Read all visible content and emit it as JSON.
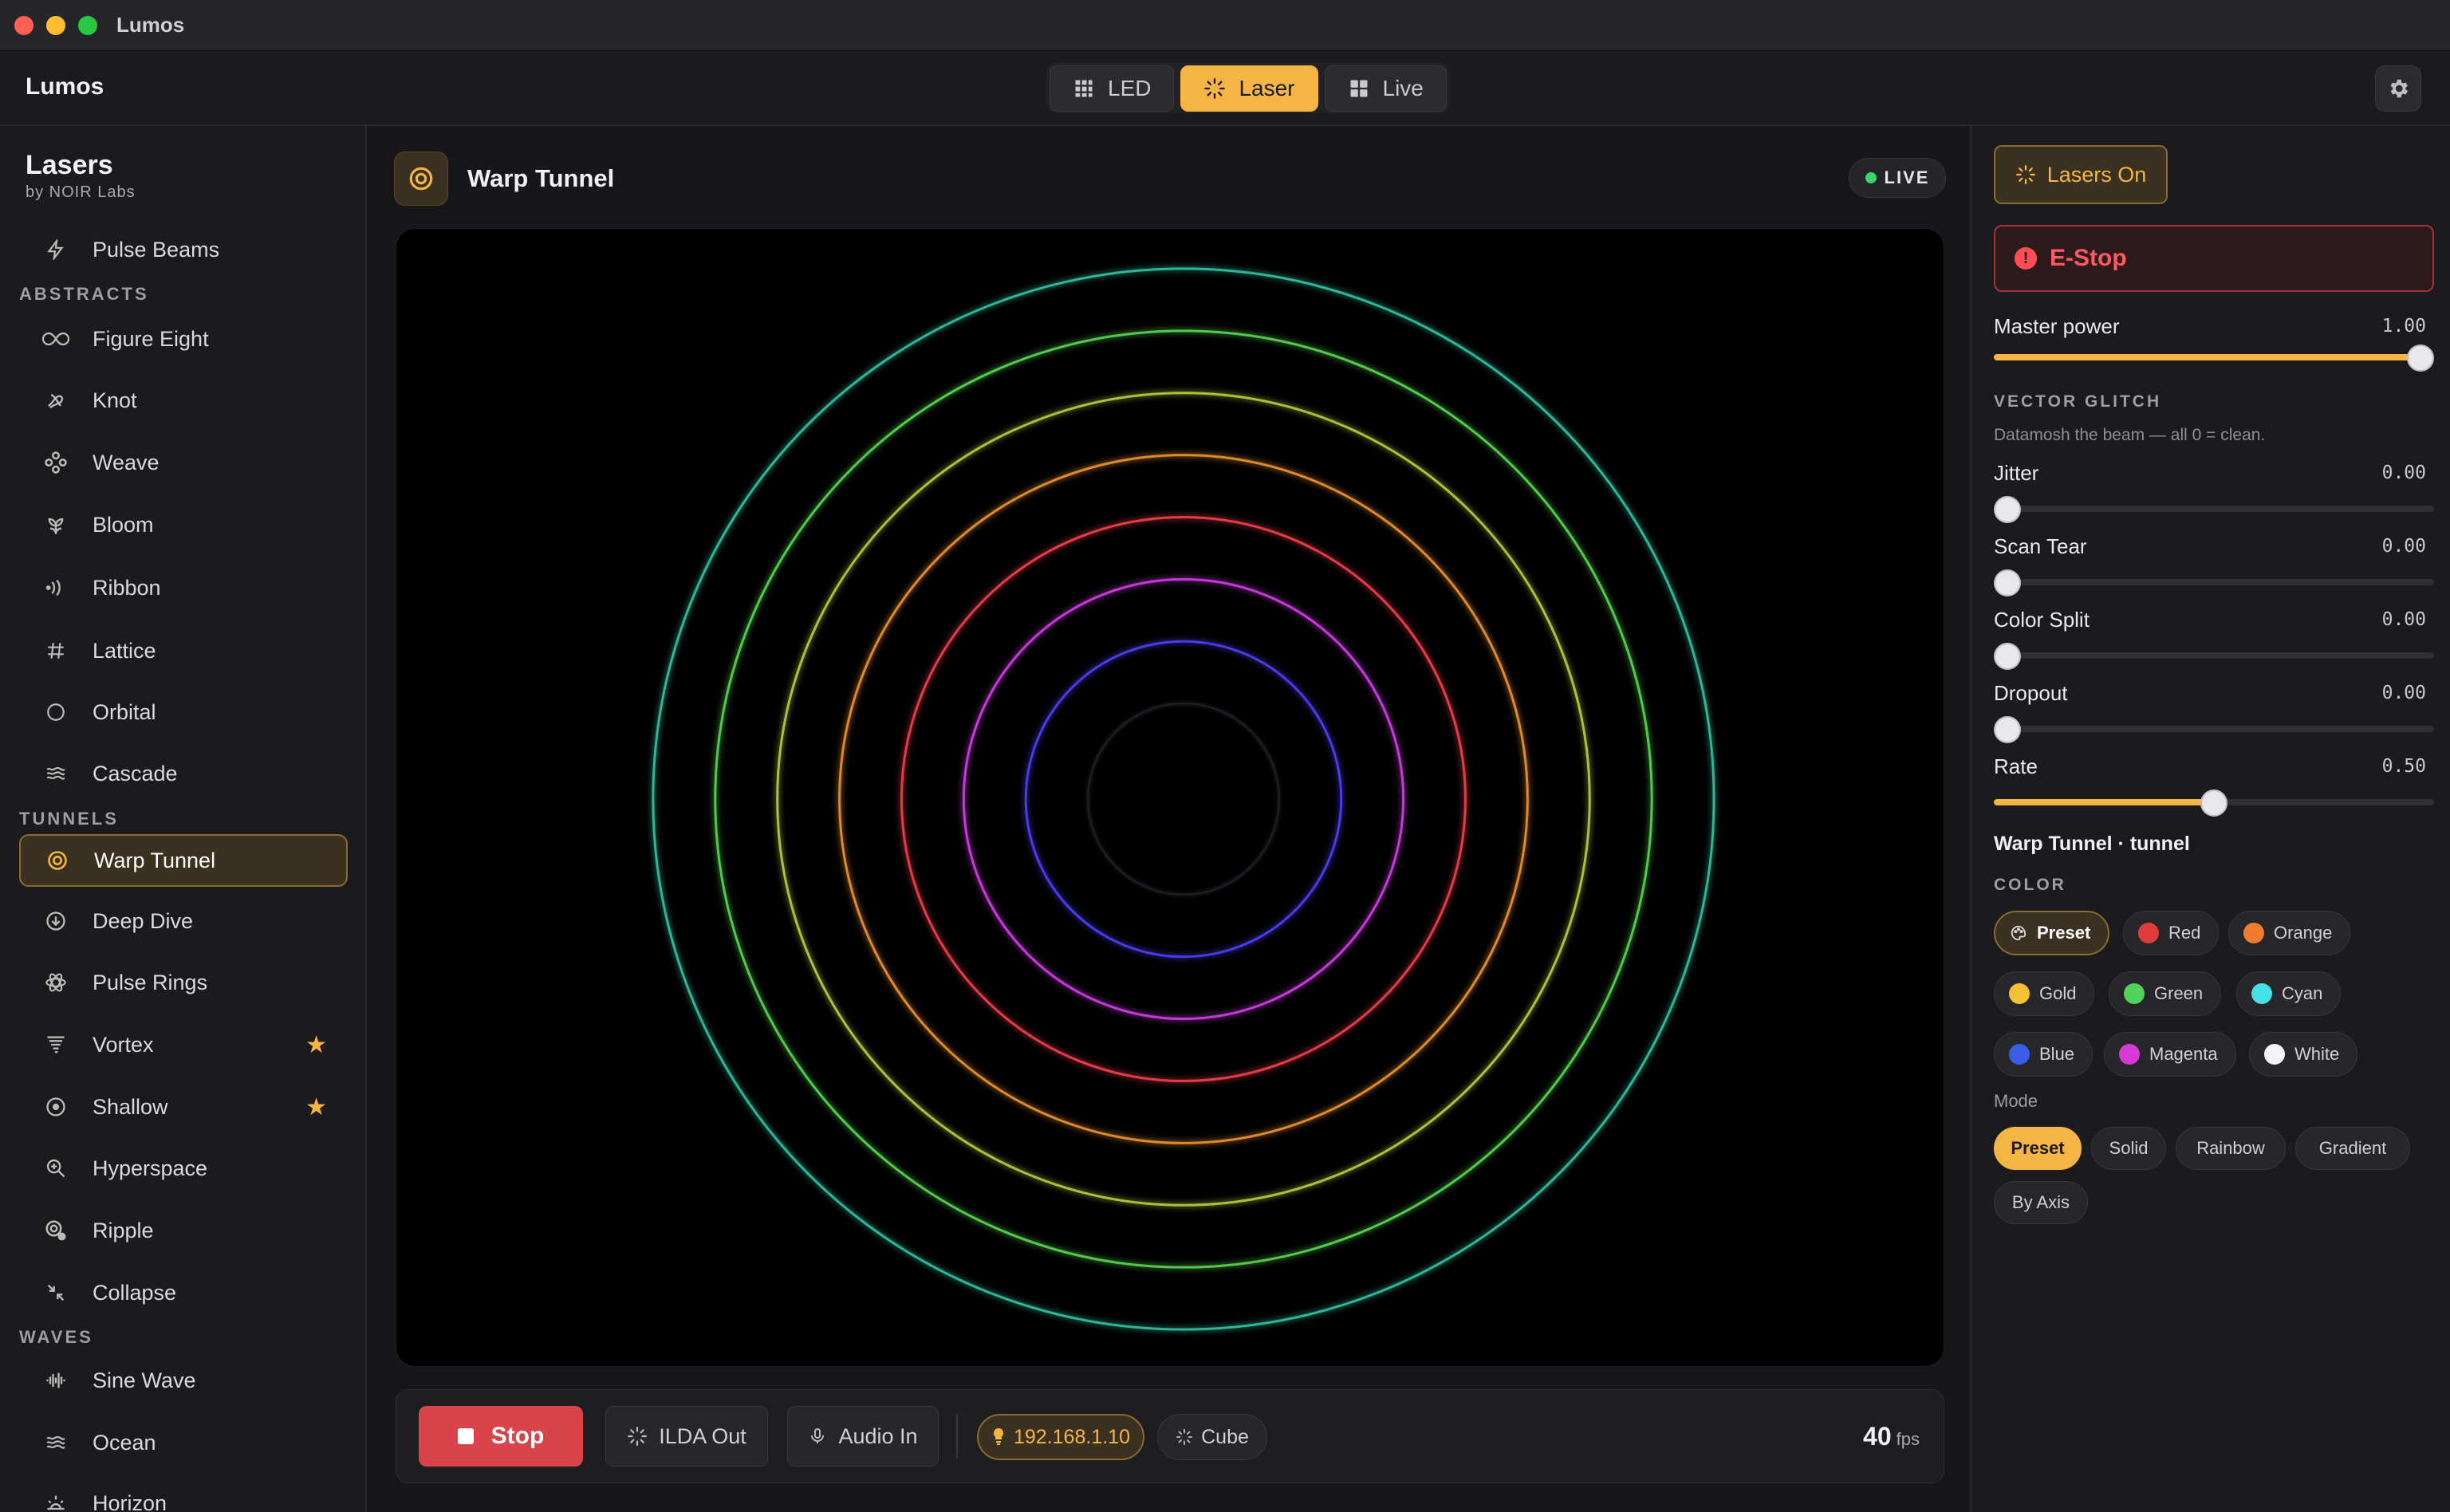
{
  "window": {
    "title": "Lumos"
  },
  "header": {
    "brand": "Lumos",
    "tabs": [
      {
        "label": "LED",
        "icon": "grid-icon",
        "active": false
      },
      {
        "label": "Laser",
        "icon": "sparkle-icon",
        "active": true
      },
      {
        "label": "Live",
        "icon": "layout-icon",
        "active": false
      }
    ]
  },
  "sidebar": {
    "title": "Lasers",
    "subtitle": "by NOIR Labs",
    "top_items": [
      {
        "label": "Pulse Beams",
        "icon": "lightning-icon"
      }
    ],
    "sections": [
      {
        "title": "ABSTRACTS",
        "items": [
          {
            "label": "Figure Eight",
            "icon": "infinity-icon"
          },
          {
            "label": "Knot",
            "icon": "knot-icon"
          },
          {
            "label": "Weave",
            "icon": "weave-icon"
          },
          {
            "label": "Bloom",
            "icon": "flower-icon"
          },
          {
            "label": "Ribbon",
            "icon": "waves-right-icon"
          },
          {
            "label": "Lattice",
            "icon": "hash-icon"
          },
          {
            "label": "Orbital",
            "icon": "circle-icon"
          },
          {
            "label": "Cascade",
            "icon": "cascade-icon"
          }
        ]
      },
      {
        "title": "TUNNELS",
        "items": [
          {
            "label": "Warp Tunnel",
            "icon": "target-icon",
            "active": true
          },
          {
            "label": "Deep Dive",
            "icon": "arrow-down-circle-icon"
          },
          {
            "label": "Pulse Rings",
            "icon": "atom-icon"
          },
          {
            "label": "Vortex",
            "icon": "tornado-icon",
            "starred": true
          },
          {
            "label": "Shallow",
            "icon": "dot-circle-icon",
            "starred": true
          },
          {
            "label": "Hyperspace",
            "icon": "zoom-icon"
          },
          {
            "label": "Ripple",
            "icon": "ripple-icon"
          },
          {
            "label": "Collapse",
            "icon": "collapse-icon"
          }
        ]
      },
      {
        "title": "WAVES",
        "items": [
          {
            "label": "Sine Wave",
            "icon": "audio-wave-icon"
          },
          {
            "label": "Ocean",
            "icon": "ocean-icon"
          },
          {
            "label": "Horizon",
            "icon": "sunrise-icon"
          }
        ]
      }
    ]
  },
  "main": {
    "title": "Warp Tunnel",
    "live_label": "LIVE",
    "rings": [
      {
        "color": "#2fb59a"
      },
      {
        "color": "#52c84e"
      },
      {
        "color": "#a9c13a"
      },
      {
        "color": "#df8a2a"
      },
      {
        "color": "#e23a4a"
      },
      {
        "color": "#c33ad6"
      },
      {
        "color": "#4a3ae8"
      },
      {
        "color": "#1e1e22"
      }
    ]
  },
  "transport": {
    "stop_label": "Stop",
    "ilda_label": "ILDA Out",
    "audio_label": "Audio In",
    "ip_label": "192.168.1.10",
    "cube_label": "Cube",
    "fps_value": "40",
    "fps_unit": "fps"
  },
  "panel": {
    "lasers_on_label": "Lasers On",
    "estop_label": "E-Stop",
    "master": {
      "label": "Master power",
      "value": "1.00",
      "level": 1.0
    },
    "glitch_title": "VECTOR GLITCH",
    "glitch_desc": "Datamosh the beam — all 0 = clean.",
    "sliders": [
      {
        "label": "Jitter",
        "value": "0.00",
        "level": 0.0
      },
      {
        "label": "Scan Tear",
        "value": "0.00",
        "level": 0.0
      },
      {
        "label": "Color Split",
        "value": "0.00",
        "level": 0.0
      },
      {
        "label": "Dropout",
        "value": "0.00",
        "level": 0.0
      },
      {
        "label": "Rate",
        "value": "0.50",
        "level": 0.5
      }
    ],
    "preset_name": "Warp Tunnel · tunnel",
    "color_title": "COLOR",
    "colors": [
      {
        "label": "Preset",
        "swatch": "palette-icon",
        "active": true
      },
      {
        "label": "Red",
        "swatch": "#e23b3b"
      },
      {
        "label": "Orange",
        "swatch": "#f07b2c"
      },
      {
        "label": "Gold",
        "swatch": "#f2c234"
      },
      {
        "label": "Green",
        "swatch": "#4fd35a"
      },
      {
        "label": "Cyan",
        "swatch": "#46e0e8"
      },
      {
        "label": "Blue",
        "swatch": "#3a5de8"
      },
      {
        "label": "Magenta",
        "swatch": "#d63ad6"
      },
      {
        "label": "White",
        "swatch": "#f4f4f4"
      }
    ],
    "mode_label": "Mode",
    "modes": [
      {
        "label": "Preset",
        "active": true
      },
      {
        "label": "Solid"
      },
      {
        "label": "Rainbow"
      },
      {
        "label": "Gradient"
      },
      {
        "label": "By Axis"
      }
    ]
  }
}
